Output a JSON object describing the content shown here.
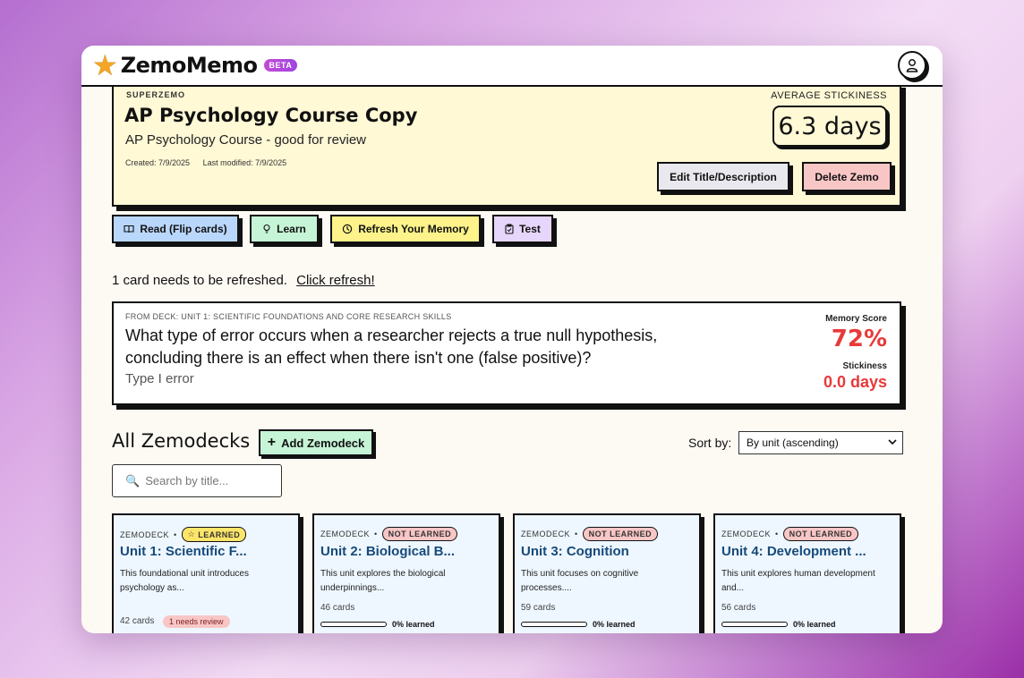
{
  "app": {
    "name": "ZemoMemo",
    "badge": "BETA"
  },
  "zemo": {
    "source_label": "SUPERZEMO",
    "title": "AP Psychology Course Copy",
    "description": "AP Psychology Course - good for review",
    "created": "Created: 7/9/2025",
    "modified": "Last modified: 7/9/2025",
    "stickiness_label": "AVERAGE STICKINESS",
    "stickiness_value": "6.3 days",
    "edit_label": "Edit Title/Description",
    "delete_label": "Delete Zemo"
  },
  "modes": {
    "read": "Read (Flip cards)",
    "learn": "Learn",
    "refresh": "Refresh Your Memory",
    "test": "Test"
  },
  "refresh": {
    "message": "1 card needs to be refreshed.",
    "link": "Click refresh!"
  },
  "review_card": {
    "deck": "FROM DECK: UNIT 1: SCIENTIFIC FOUNDATIONS AND CORE RESEARCH SKILLS",
    "question": "What type of error occurs when a researcher rejects a true null hypothesis, concluding there is an effect when there isn't one (false positive)?",
    "answer": "Type I error",
    "memory_label": "Memory Score",
    "memory_value": "72%",
    "stickiness_label": "Stickiness",
    "stickiness_value": "0.0 days"
  },
  "decks": {
    "heading": "All Zemodecks",
    "add_label": "Add Zemodeck",
    "sort_label": "Sort by:",
    "sort_value": "By unit (ascending)",
    "search_placeholder": "Search by title...",
    "items": [
      {
        "label": "ZEMODECK",
        "status": "LEARNED",
        "title": "Unit 1: Scientific F...",
        "desc": "This foundational unit introduces psychology as...",
        "count": "42 cards",
        "review": "1 needs review"
      },
      {
        "label": "ZEMODECK",
        "status": "NOT LEARNED",
        "title": "Unit 2: Biological B...",
        "desc": "This unit explores the biological underpinnings...",
        "count": "46 cards",
        "progress": 0,
        "progress_text": "0% learned"
      },
      {
        "label": "ZEMODECK",
        "status": "NOT LEARNED",
        "title": "Unit 3: Cognition",
        "desc": "This unit focuses on cognitive processes....",
        "count": "59 cards",
        "progress": 0,
        "progress_text": "0% learned"
      },
      {
        "label": "ZEMODECK",
        "status": "NOT LEARNED",
        "title": "Unit 4: Development ...",
        "desc": "This unit explores human development and...",
        "count": "56 cards",
        "progress": 0,
        "progress_text": "0% learned"
      }
    ]
  },
  "colors": {
    "accent_red": "#e83a3a",
    "deck_title": "#174a7a",
    "brand_star": "#f5a623"
  }
}
